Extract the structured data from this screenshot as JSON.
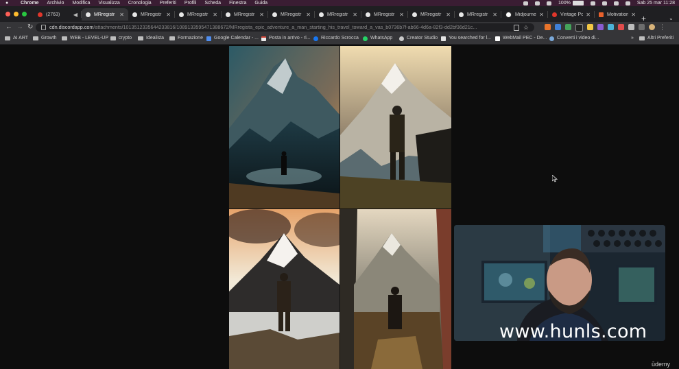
{
  "menubar": {
    "apple": "",
    "items": [
      "Chrome",
      "Archivio",
      "Modifica",
      "Visualizza",
      "Cronologia",
      "Preferiti",
      "Profili",
      "Scheda",
      "Finestra",
      "Guida"
    ],
    "battery": "100%",
    "datetime": "Sab 25 mar  11:28"
  },
  "tabs": [
    {
      "label": "(2763)",
      "favicon": "tiktok",
      "active": false
    },
    {
      "label": "MRregistr",
      "favicon": "discord",
      "active": true
    },
    {
      "label": "MRregistr",
      "favicon": "discord",
      "active": false
    },
    {
      "label": "MRregistr",
      "favicon": "discord",
      "active": false
    },
    {
      "label": "MRregistr",
      "favicon": "discord",
      "active": false
    },
    {
      "label": "MRregistr",
      "favicon": "discord",
      "active": false
    },
    {
      "label": "MRregistr",
      "favicon": "discord",
      "active": false
    },
    {
      "label": "MRregistr",
      "favicon": "discord",
      "active": false
    },
    {
      "label": "MRregistr",
      "favicon": "discord",
      "active": false
    },
    {
      "label": "MRregistr",
      "favicon": "discord",
      "active": false
    },
    {
      "label": "Midjourney",
      "favicon": "midjourney",
      "active": false
    },
    {
      "label": "Vintage Po",
      "favicon": "youtube",
      "active": false
    },
    {
      "label": "Motivation",
      "favicon": "motivation",
      "active": false
    }
  ],
  "address": {
    "host": "cdn.discordapp.com",
    "path": "/attachments/1013512335644233816/1089133595471388672/MRregista_epic_adventure_a_man_starting_his_travel_toward_a_vas_b0736b7f-ab66-4d6a-82f3-dd2bf36d21c..."
  },
  "bookmarks": [
    {
      "label": "AI ART",
      "icon": "folder"
    },
    {
      "label": "Growth",
      "icon": "folder"
    },
    {
      "label": "WEB - LEVEL-UP",
      "icon": "folder"
    },
    {
      "label": "crypto",
      "icon": "folder"
    },
    {
      "label": "Idealista",
      "icon": "folder"
    },
    {
      "label": "Formazione",
      "icon": "folder"
    },
    {
      "label": "Google Calendar - ...",
      "icon": "calendar"
    },
    {
      "label": "Posta in arrivo - ri...",
      "icon": "gmail"
    },
    {
      "label": "Riccardo Scrocca",
      "icon": "facebook"
    },
    {
      "label": "WhatsApp",
      "icon": "whatsapp"
    },
    {
      "label": "Creator Studio",
      "icon": "creator"
    },
    {
      "label": "You searched for l...",
      "icon": "page"
    },
    {
      "label": "WebMail PEC - De...",
      "icon": "mail"
    },
    {
      "label": "Converti i video di...",
      "icon": "convert"
    },
    {
      "label": "»",
      "icon": "none"
    },
    {
      "label": "Altri Preferiti",
      "icon": "folder"
    }
  ],
  "overlay": {
    "watermark": "www.hunls.com",
    "brand": "ūdemy"
  }
}
